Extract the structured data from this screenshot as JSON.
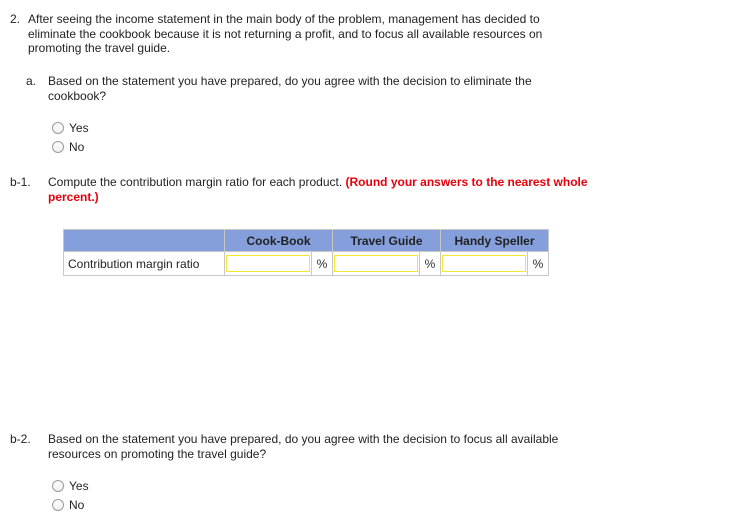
{
  "question2": {
    "number": "2.",
    "text_lines": [
      "After seeing the income statement in the main body of the problem, management has decided to",
      "eliminate the cookbook because it is not returning a profit, and to focus all available resources on",
      "promoting the travel guide."
    ]
  },
  "part_a": {
    "label": "a.",
    "text_lines": [
      "Based on the statement you have prepared, do you agree with the decision to eliminate the",
      "cookbook?"
    ],
    "options": [
      "Yes",
      "No"
    ],
    "selected": null
  },
  "part_b1": {
    "label": "b-1.",
    "text_line1": "Compute the contribution margin ratio for each product.",
    "instruction_line1": "(Round your answers to the nearest whole",
    "instruction_line2": "percent.)",
    "table": {
      "header_color": "#849fdb",
      "columns": [
        "Cook-Book",
        "Travel Guide",
        "Handy Speller"
      ],
      "row_label": "Contribution margin ratio",
      "values": [
        "",
        "",
        ""
      ],
      "unit": "%"
    }
  },
  "part_b2": {
    "label": "b-2.",
    "text_lines": [
      "Based on the statement you have prepared, do you agree with the decision to focus all available",
      "resources on promoting the travel guide?"
    ],
    "options": [
      "Yes",
      "No"
    ],
    "selected": null
  }
}
